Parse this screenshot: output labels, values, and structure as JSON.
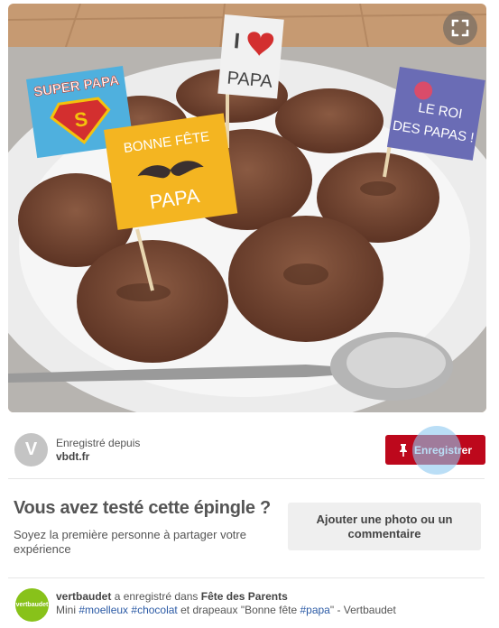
{
  "image": {
    "expand_icon": "expand-corners-icon",
    "flags": {
      "super_papa": "SUPER PAPA",
      "heart_papa_i": "I",
      "heart_papa_word": "PAPA",
      "bonne_fete_1": "BONNE FÊTE",
      "bonne_fete_2": "PAPA",
      "roi_1": "LE ROI",
      "roi_2": "DES PAPAS !"
    },
    "colors": {
      "table": "#c69a72",
      "plate": "#ececec",
      "muffin": "#7a4a36",
      "flag_blue": "#4fb0de",
      "flag_yellow": "#f4b521",
      "flag_purple": "#6a6cb5"
    }
  },
  "source": {
    "avatar_letter": "V",
    "saved_from_label": "Enregistré depuis",
    "domain": "vbdt.fr",
    "save_button_label": "Enregistrer",
    "save_icon": "pushpin-icon"
  },
  "tried": {
    "title": "Vous avez testé cette épingle ?",
    "subtitle": "Soyez la première personne à partager votre expérience",
    "add_button_label": "Ajouter une photo ou un commentaire"
  },
  "activity": {
    "avatar_label": "vertbaudet",
    "user": "vertbaudet",
    "action": " a enregistré dans ",
    "board": "Fête des Parents",
    "desc_prefix": "Mini ",
    "tag1": "#moelleux",
    "space1": " ",
    "tag2": "#chocolat",
    "desc_mid": " et drapeaux \"Bonne fête ",
    "tag3": "#papa",
    "desc_suffix": "\" - Vertbaudet"
  }
}
